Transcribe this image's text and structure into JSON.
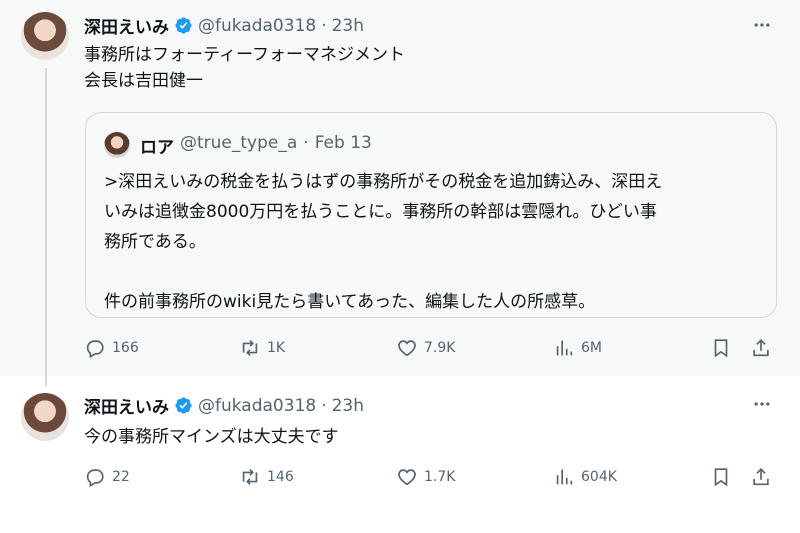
{
  "tweets": [
    {
      "name": "深田えいみ",
      "handle": "@fukada0318",
      "time": "23h",
      "text": "事務所はフォーティーフォーマネジメント\n会長は吉田健一",
      "quote": {
        "name": "ロア",
        "handle": "@true_type_a",
        "date": "Feb 13",
        "text": ">深田えいみの税金を払うはずの事務所がその税金を追加鋳込み、深田え\nいみは追徴金8000万円を払うことに。事務所の幹部は雲隠れ。ひどい事\n務所である。\n\n件の前事務所のwiki見たら書いてあった、編集した人の所感草。"
      },
      "stats": {
        "replies": "166",
        "reposts": "1K",
        "likes": "7.9K",
        "views": "6M"
      }
    },
    {
      "name": "深田えいみ",
      "handle": "@fukada0318",
      "time": "23h",
      "text": "今の事務所マインズは大丈夫です",
      "stats": {
        "replies": "22",
        "reposts": "146",
        "likes": "1.7K",
        "views": "604K"
      }
    }
  ],
  "separator": "·",
  "colors": {
    "verified": "#1d9bf0",
    "muted": "#536471",
    "text": "#0f1419",
    "border": "#cfd9de"
  },
  "icons": [
    "more-icon",
    "reply-icon",
    "repost-icon",
    "like-icon",
    "views-icon",
    "bookmark-icon",
    "share-icon",
    "verified-badge-icon"
  ]
}
